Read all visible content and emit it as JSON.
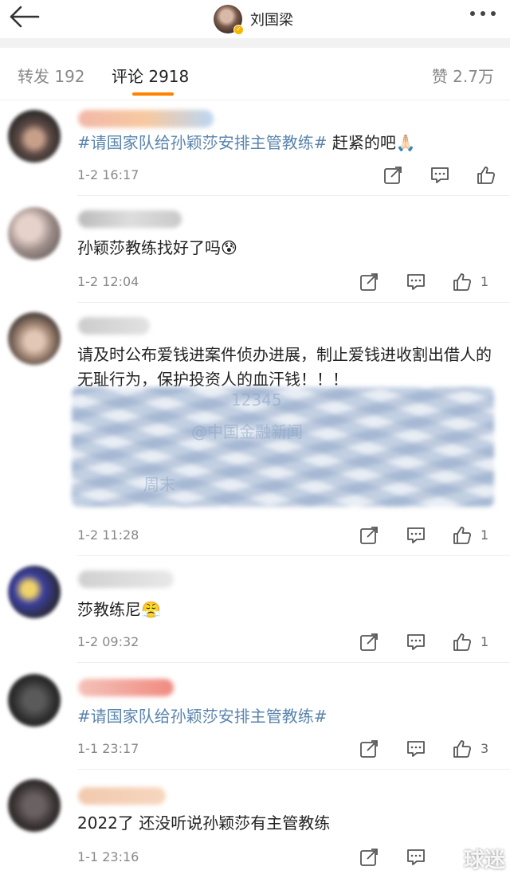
{
  "header": {
    "username": "刘国梁",
    "back_icon": "back-arrow-icon",
    "more_icon": "more-dots-icon"
  },
  "tabs": {
    "repost": "转发 192",
    "comment": "评论 2918",
    "like": "赞 2.7万"
  },
  "colors": {
    "accent": "#ff8200",
    "hashtag": "#5a84ad",
    "verified": "#f7b500"
  },
  "comments": [
    {
      "tag": "#请国家队给孙颖莎安排主管教练#",
      "text": " 赶紧的吧🙏🏻",
      "date": "1-2 16:17",
      "likes": ""
    },
    {
      "tag": "",
      "text": "孙颖莎教练找好了吗😰",
      "date": "1-2 12:04",
      "likes": "1"
    },
    {
      "tag": "",
      "text": "请及时公布爱钱进案件侦办进展，制止爱钱进收割出借人的无耻行为，保护投资人的血汗钱！！！",
      "date": "1-2 11:28",
      "likes": "1",
      "veiled_fragments": [
        "12345",
        "@中国金融新闻",
        "周末"
      ]
    },
    {
      "tag": "",
      "text": "莎教练尼😤",
      "date": "1-2 09:32",
      "likes": "1"
    },
    {
      "tag": "#请国家队给孙颖莎安排主管教练#",
      "text": "",
      "date": "1-1 23:17",
      "likes": "3"
    },
    {
      "tag": "",
      "text": "2022了 还没听说孙颖莎有主管教练",
      "date": "1-1 23:16",
      "likes": ""
    }
  ],
  "watermark": "球迷"
}
